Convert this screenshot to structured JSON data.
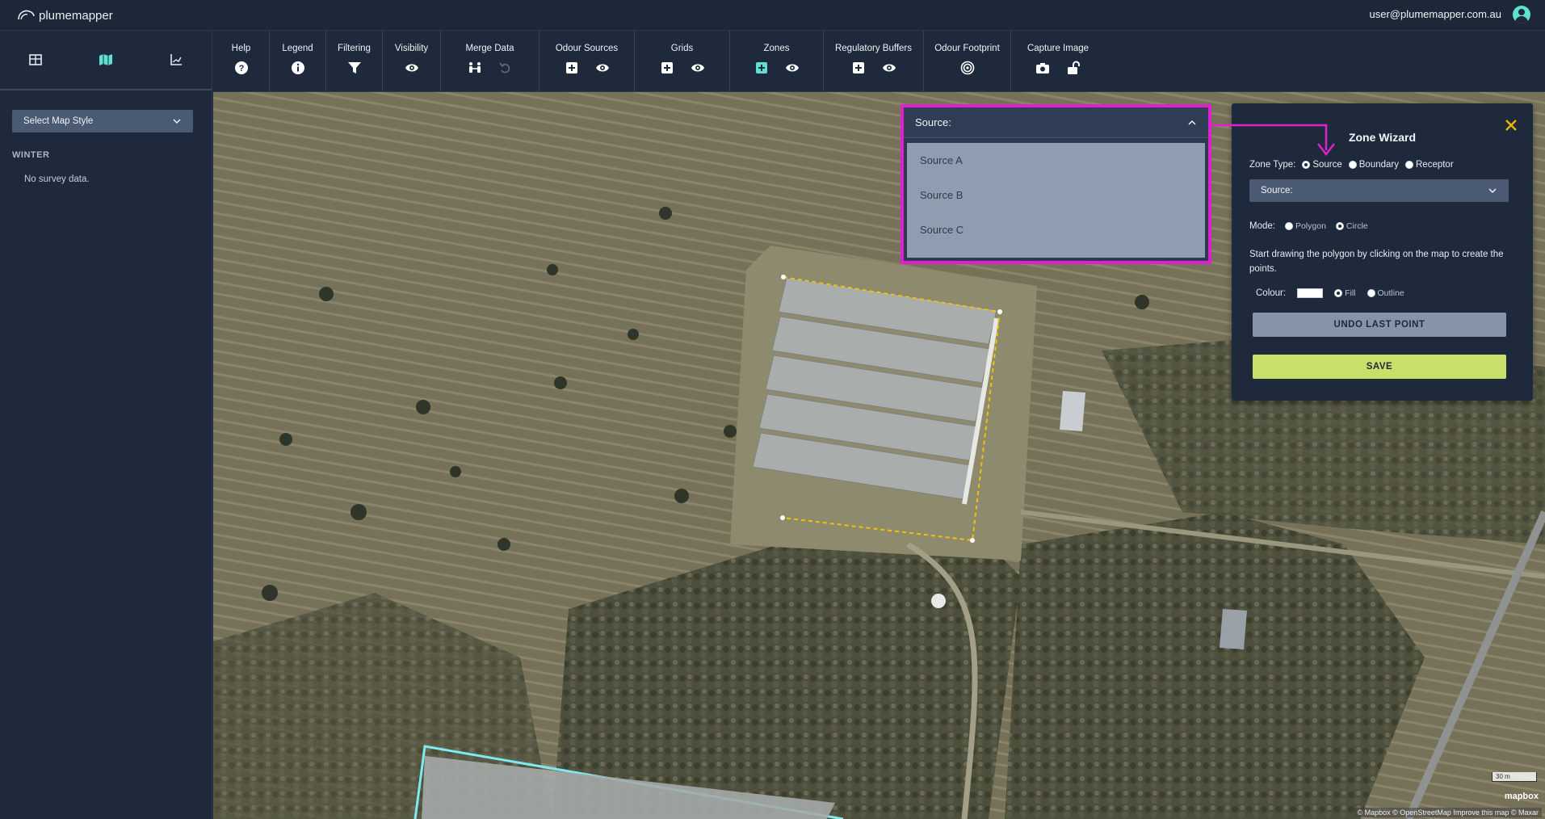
{
  "app": {
    "logo_text": "plumemapper",
    "user_email": "user@plumemapper.com.au"
  },
  "sidebar": {
    "tabs": [
      "table-icon",
      "map-icon",
      "chart-icon"
    ],
    "map_style_select": "Select Map Style",
    "season_label": "WINTER",
    "no_data_text": "No survey data."
  },
  "toolbar": {
    "help": "Help",
    "legend": "Legend",
    "filtering": "Filtering",
    "visibility": "Visibility",
    "merge_data": "Merge Data",
    "odour_sources": "Odour Sources",
    "grids": "Grids",
    "zones": "Zones",
    "regulatory_buffers": "Regulatory Buffers",
    "odour_footprint": "Odour Footprint",
    "capture_image": "Capture Image"
  },
  "source_dropdown": {
    "label": "Source:",
    "options": [
      "Source A",
      "Source B",
      "Source C"
    ]
  },
  "zone_wizard": {
    "title": "Zone Wizard",
    "zone_type_label": "Zone Type:",
    "zone_types": [
      "Source",
      "Boundary",
      "Receptor"
    ],
    "zone_type_selected": "Source",
    "source_select": "Source:",
    "mode_label": "Mode:",
    "modes": [
      "Polygon",
      "Circle"
    ],
    "description": "Start drawing the polygon by clicking on the map to create the points.",
    "colour_label": "Colour:",
    "colour_value": "#ffffff",
    "fill_options": [
      "Fill",
      "Outline"
    ],
    "fill_selected": "Fill",
    "undo_button": "UNDO LAST POINT",
    "save_button": "SAVE"
  },
  "map": {
    "scale_label": "30 m",
    "mapbox_label": "mapbox",
    "attribution": "© Mapbox © OpenStreetMap Improve this map © Maxar"
  },
  "colors": {
    "highlight": "#e020d0",
    "accent": "#5fe0d2",
    "save": "#c8e06a"
  }
}
